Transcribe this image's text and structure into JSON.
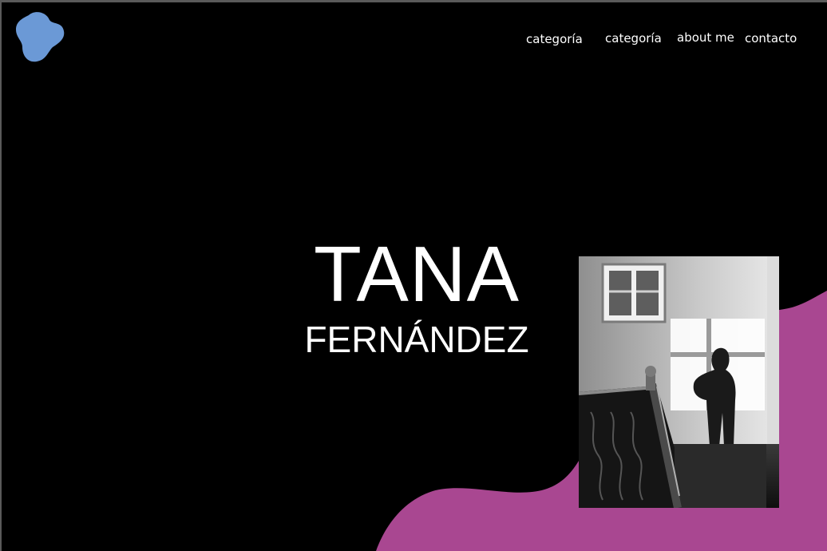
{
  "logo": {
    "icon": "blob-logo-icon",
    "color": "#6b99d6"
  },
  "nav": {
    "items": [
      {
        "label": "categoría"
      },
      {
        "label": "categoría"
      },
      {
        "label": "about me"
      },
      {
        "label": "contacto"
      }
    ]
  },
  "hero": {
    "first_name": "TANA",
    "last_name": "FERNÁNDEZ"
  },
  "photo": {
    "subject": "black-and-white photo of a staircase with a silhouette shadow on the wall"
  },
  "colors": {
    "background": "#000000",
    "accent_wave": "#a94791",
    "text": "#ffffff",
    "logo": "#6b99d6"
  }
}
